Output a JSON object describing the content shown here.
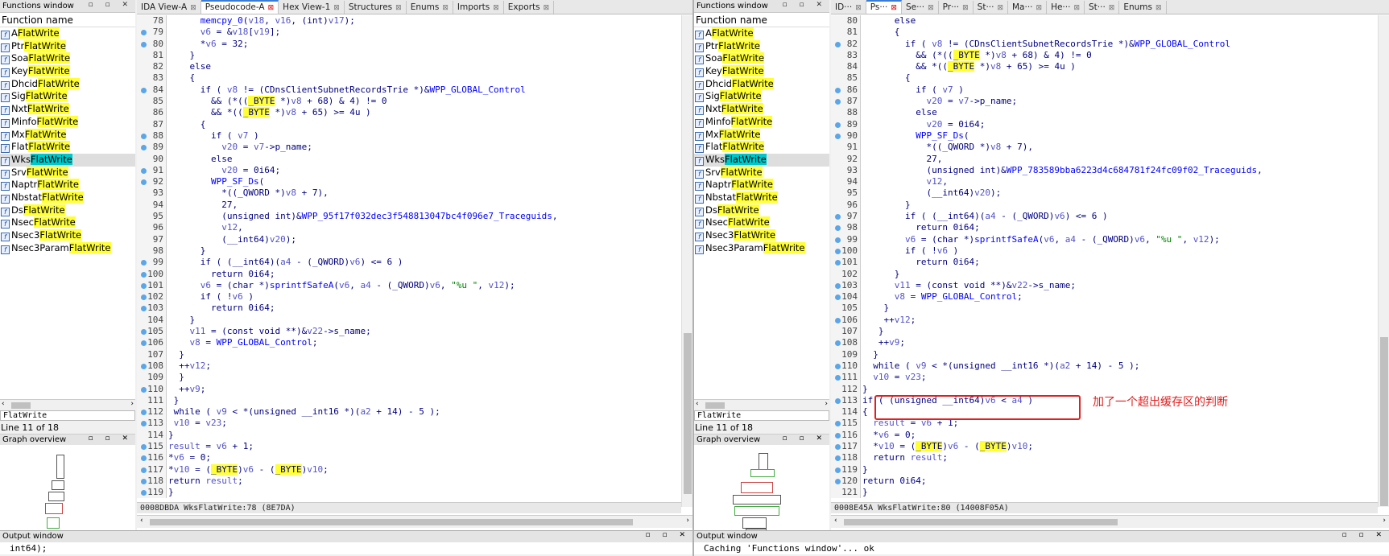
{
  "left": {
    "functions_window": {
      "title": "Functions window",
      "header": "Function name",
      "items": [
        {
          "prefix": "A",
          "suffix": "FlatWrite"
        },
        {
          "prefix": "Ptr",
          "suffix": "FlatWrite"
        },
        {
          "prefix": "Soa",
          "suffix": "FlatWrite"
        },
        {
          "prefix": "Key",
          "suffix": "FlatWrite"
        },
        {
          "prefix": "Dhcid",
          "suffix": "FlatWrite"
        },
        {
          "prefix": "Sig",
          "suffix": "FlatWrite"
        },
        {
          "prefix": "Nxt",
          "suffix": "FlatWrite"
        },
        {
          "prefix": "Minfo",
          "suffix": "FlatWrite"
        },
        {
          "prefix": "Mx",
          "suffix": "FlatWrite"
        },
        {
          "prefix": "Flat",
          "suffix": "FlatWrite"
        },
        {
          "prefix": "Wks",
          "suffix": "FlatWrite"
        },
        {
          "prefix": "Srv",
          "suffix": "FlatWrite"
        },
        {
          "prefix": "Naptr",
          "suffix": "FlatWrite"
        },
        {
          "prefix": "Nbstat",
          "suffix": "FlatWrite"
        },
        {
          "prefix": "Ds",
          "suffix": "FlatWrite"
        },
        {
          "prefix": "Nsec",
          "suffix": "FlatWrite"
        },
        {
          "prefix": "Nsec3",
          "suffix": "FlatWrite"
        },
        {
          "prefix": "Nsec3Param",
          "suffix": "FlatWrite"
        }
      ],
      "filter": "FlatWrite",
      "line_count": "Line 11 of 18"
    },
    "graph_overview_title": "Graph overview",
    "tabs": [
      {
        "label": "IDA View-A",
        "close": "⊠"
      },
      {
        "label": "Pseudocode-A",
        "close": "⊠"
      },
      {
        "label": "Hex View-1",
        "close": "⊠"
      },
      {
        "label": "Structures",
        "close": "⊠"
      },
      {
        "label": "Enums",
        "close": "⊠"
      },
      {
        "label": "Imports",
        "close": "⊠"
      },
      {
        "label": "Exports",
        "close": "⊠"
      }
    ],
    "code_lines": [
      {
        "n": "78",
        "t": "      memcpy_0(v18, v16, (int)v17);"
      },
      {
        "n": "79",
        "t": "      v6 = &v18[v19];"
      },
      {
        "n": "80",
        "t": "      *v6 = 32;"
      },
      {
        "n": "81",
        "t": "    }"
      },
      {
        "n": "82",
        "t": "    else"
      },
      {
        "n": "83",
        "t": "    {"
      },
      {
        "n": "84",
        "t": "      if ( v8 != (CDnsClientSubnetRecordsTrie *)&WPP_GLOBAL_Control"
      },
      {
        "n": "85",
        "t": "        && (*((_BYTE *)v8 + 68) & 4) != 0"
      },
      {
        "n": "86",
        "t": "        && *((_BYTE *)v8 + 65) >= 4u )"
      },
      {
        "n": "87",
        "t": "      {"
      },
      {
        "n": "88",
        "t": "        if ( v7 )"
      },
      {
        "n": "89",
        "t": "          v20 = v7->p_name;"
      },
      {
        "n": "90",
        "t": "        else"
      },
      {
        "n": "91",
        "t": "          v20 = 0i64;"
      },
      {
        "n": "92",
        "t": "        WPP_SF_Ds("
      },
      {
        "n": "93",
        "t": "          *((_QWORD *)v8 + 7),"
      },
      {
        "n": "94",
        "t": "          27,"
      },
      {
        "n": "95",
        "t": "          (unsigned int)&WPP_95f17f032dec3f548813047bc4f096e7_Traceguids,"
      },
      {
        "n": "96",
        "t": "          v12,"
      },
      {
        "n": "97",
        "t": "          (__int64)v20);"
      },
      {
        "n": "98",
        "t": "      }"
      },
      {
        "n": "99",
        "t": "      if ( (__int64)(a4 - (_QWORD)v6) <= 6 )"
      },
      {
        "n": "100",
        "t": "        return 0i64;"
      },
      {
        "n": "101",
        "t": "      v6 = (char *)sprintfSafeA(v6, a4 - (_QWORD)v6, \"%u \", v12);"
      },
      {
        "n": "102",
        "t": "      if ( !v6 )"
      },
      {
        "n": "103",
        "t": "        return 0i64;"
      },
      {
        "n": "104",
        "t": "    }"
      },
      {
        "n": "105",
        "t": "    v11 = (const void **)&v22->s_name;"
      },
      {
        "n": "106",
        "t": "    v8 = WPP_GLOBAL_Control;"
      },
      {
        "n": "107",
        "t": "  }"
      },
      {
        "n": "108",
        "t": "  ++v12;"
      },
      {
        "n": "109",
        "t": "  }"
      },
      {
        "n": "110",
        "t": "  ++v9;"
      },
      {
        "n": "111",
        "t": " }"
      },
      {
        "n": "112",
        "t": " while ( v9 < *(unsigned __int16 *)(a2 + 14) - 5 );"
      },
      {
        "n": "113",
        "t": " v10 = v23;"
      },
      {
        "n": "114",
        "t": "}"
      },
      {
        "n": "115",
        "t": "result = v6 + 1;"
      },
      {
        "n": "116",
        "t": "*v6 = 0;"
      },
      {
        "n": "117",
        "t": "*v10 = (_BYTE)v6 - (_BYTE)v10;"
      },
      {
        "n": "118",
        "t": "return result;"
      },
      {
        "n": "119",
        "t": "}"
      }
    ],
    "status": "0008DBDA WksFlatWrite:78 (8E7DA)",
    "output_title": "Output window",
    "output_text": "int64);"
  },
  "right": {
    "functions_window": {
      "title": "Functions window",
      "header": "Function name",
      "items": [
        {
          "prefix": "A",
          "suffix": "FlatWrite"
        },
        {
          "prefix": "Ptr",
          "suffix": "FlatWrite"
        },
        {
          "prefix": "Soa",
          "suffix": "FlatWrite"
        },
        {
          "prefix": "Key",
          "suffix": "FlatWrite"
        },
        {
          "prefix": "Dhcid",
          "suffix": "FlatWrite"
        },
        {
          "prefix": "Sig",
          "suffix": "FlatWrite"
        },
        {
          "prefix": "Nxt",
          "suffix": "FlatWrite"
        },
        {
          "prefix": "Minfo",
          "suffix": "FlatWrite"
        },
        {
          "prefix": "Mx",
          "suffix": "FlatWrite"
        },
        {
          "prefix": "Flat",
          "suffix": "FlatWrite"
        },
        {
          "prefix": "Wks",
          "suffix": "FlatWrite"
        },
        {
          "prefix": "Srv",
          "suffix": "FlatWrite"
        },
        {
          "prefix": "Naptr",
          "suffix": "FlatWrite"
        },
        {
          "prefix": "Nbstat",
          "suffix": "FlatWrite"
        },
        {
          "prefix": "Ds",
          "suffix": "FlatWrite"
        },
        {
          "prefix": "Nsec",
          "suffix": "FlatWrite"
        },
        {
          "prefix": "Nsec3",
          "suffix": "FlatWrite"
        },
        {
          "prefix": "Nsec3Param",
          "suffix": "FlatWrite"
        }
      ],
      "filter": "FlatWrite",
      "line_count": "Line 11 of 18"
    },
    "graph_overview_title": "Graph overview",
    "tabs": [
      {
        "label": "ID···",
        "close": "⊠"
      },
      {
        "label": "Ps···",
        "close": "⊠"
      },
      {
        "label": "Se···",
        "close": "⊠"
      },
      {
        "label": "Pr···",
        "close": "⊠"
      },
      {
        "label": "St···",
        "close": "⊠"
      },
      {
        "label": "Ma···",
        "close": "⊠"
      },
      {
        "label": "He···",
        "close": "⊠"
      },
      {
        "label": "St···",
        "close": "⊠"
      },
      {
        "label": "Enums",
        "close": "⊠"
      }
    ],
    "code_lines": [
      {
        "n": "80",
        "t": "      else"
      },
      {
        "n": "81",
        "t": "      {"
      },
      {
        "n": "82",
        "t": "        if ( v8 != (CDnsClientSubnetRecordsTrie *)&WPP_GLOBAL_Control"
      },
      {
        "n": "83",
        "t": "          && (*((_BYTE *)v8 + 68) & 4) != 0"
      },
      {
        "n": "84",
        "t": "          && *((_BYTE *)v8 + 65) >= 4u )"
      },
      {
        "n": "85",
        "t": "        {"
      },
      {
        "n": "86",
        "t": "          if ( v7 )"
      },
      {
        "n": "87",
        "t": "            v20 = v7->p_name;"
      },
      {
        "n": "88",
        "t": "          else"
      },
      {
        "n": "89",
        "t": "            v20 = 0i64;"
      },
      {
        "n": "90",
        "t": "          WPP_SF_Ds("
      },
      {
        "n": "91",
        "t": "            *((_QWORD *)v8 + 7),"
      },
      {
        "n": "92",
        "t": "            27,"
      },
      {
        "n": "93",
        "t": "            (unsigned int)&WPP_783589bba6223d4c684781f24fc09f02_Traceguids,"
      },
      {
        "n": "94",
        "t": "            v12,"
      },
      {
        "n": "95",
        "t": "            (__int64)v20);"
      },
      {
        "n": "96",
        "t": "        }"
      },
      {
        "n": "97",
        "t": "        if ( (__int64)(a4 - (_QWORD)v6) <= 6 )"
      },
      {
        "n": "98",
        "t": "          return 0i64;"
      },
      {
        "n": "99",
        "t": "        v6 = (char *)sprintfSafeA(v6, a4 - (_QWORD)v6, \"%u \", v12);"
      },
      {
        "n": "100",
        "t": "        if ( !v6 )"
      },
      {
        "n": "101",
        "t": "          return 0i64;"
      },
      {
        "n": "102",
        "t": "      }"
      },
      {
        "n": "103",
        "t": "      v11 = (const void **)&v22->s_name;"
      },
      {
        "n": "104",
        "t": "      v8 = WPP_GLOBAL_Control;"
      },
      {
        "n": "105",
        "t": "    }"
      },
      {
        "n": "106",
        "t": "    ++v12;"
      },
      {
        "n": "107",
        "t": "   }"
      },
      {
        "n": "108",
        "t": "   ++v9;"
      },
      {
        "n": "109",
        "t": "  }"
      },
      {
        "n": "110",
        "t": "  while ( v9 < *(unsigned __int16 *)(a2 + 14) - 5 );"
      },
      {
        "n": "111",
        "t": "  v10 = v23;"
      },
      {
        "n": "112",
        "t": "}"
      },
      {
        "n": "113",
        "t": "if ( (unsigned __int64)v6 < a4 )"
      },
      {
        "n": "114",
        "t": "{"
      },
      {
        "n": "115",
        "t": "  result = v6 + 1;"
      },
      {
        "n": "116",
        "t": "  *v6 = 0;"
      },
      {
        "n": "117",
        "t": "  *v10 = (_BYTE)v6 - (_BYTE)v10;"
      },
      {
        "n": "118",
        "t": "  return result;"
      },
      {
        "n": "119",
        "t": "}"
      },
      {
        "n": "120",
        "t": "return 0i64;"
      },
      {
        "n": "121",
        "t": "}"
      }
    ],
    "status": "0008E45A WksFlatWrite:80 (14008F05A)",
    "output_title": "Output window",
    "output_text": "Caching 'Functions window'... ok",
    "annotation": "加了一个超出缓存区的判断"
  },
  "colors": {
    "highlight": "#ffff33",
    "selected_highlight": "#00c8c8",
    "annotation_red": "#e02020",
    "breakpoint_dot": "#5aa6e8"
  }
}
